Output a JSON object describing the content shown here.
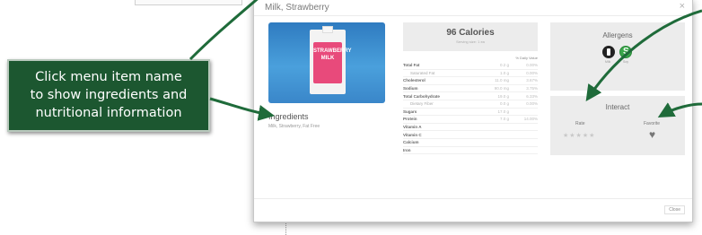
{
  "modal": {
    "title": "Milk, Strawberry",
    "close_glyph": "×",
    "footer_close": "Close"
  },
  "product": {
    "image_alt": "Strawberry milk carton",
    "carton_text": "STRAWBERRY MILK"
  },
  "ingredients": {
    "heading": "Ingredients",
    "text": "Milk, Strawberry, Fat Free"
  },
  "nutrition": {
    "calories": "96 Calories",
    "serving": "Serving size: 1 ea",
    "dv_header": "% Daily Value",
    "rows": [
      {
        "name": "Total Fat",
        "amount": "0.2 g",
        "pct": "0.00%",
        "sub": false
      },
      {
        "name": "Saturated Fat",
        "amount": "1.0 g",
        "pct": "0.00%",
        "sub": true
      },
      {
        "name": "Cholesterol",
        "amount": "11.0 mg",
        "pct": "3.67%",
        "sub": false
      },
      {
        "name": "Sodium",
        "amount": "90.0 mg",
        "pct": "3.75%",
        "sub": false
      },
      {
        "name": "Total Carbohydrate",
        "amount": "19.0 g",
        "pct": "6.33%",
        "sub": false
      },
      {
        "name": "Dietary Fiber",
        "amount": "0.0 g",
        "pct": "0.00%",
        "sub": true
      },
      {
        "name": "Sugars",
        "amount": "17.0 g",
        "pct": "",
        "sub": false
      },
      {
        "name": "Protein",
        "amount": "7.0 g",
        "pct": "14.00%",
        "sub": false
      },
      {
        "name": "Vitamin A",
        "amount": "",
        "pct": "",
        "sub": false
      },
      {
        "name": "Vitamin C",
        "amount": "",
        "pct": "",
        "sub": false
      },
      {
        "name": "Calcium",
        "amount": "",
        "pct": "",
        "sub": false
      },
      {
        "name": "Iron",
        "amount": "",
        "pct": "",
        "sub": false
      }
    ]
  },
  "allergens": {
    "title": "Allergens",
    "items": [
      {
        "icon": "milk-icon",
        "label": "Milk",
        "color": "#222222"
      },
      {
        "icon": "soy-icon",
        "label": "Soy",
        "color": "#3aa64a"
      }
    ]
  },
  "interact": {
    "title": "Interact",
    "rate_label": "Rate",
    "favorite_label": "Favorite",
    "stars": "★★★★★",
    "heart": "♥"
  },
  "callout": {
    "line1": "Click menu item name",
    "line2": "to show ingredients and",
    "line3": "nutritional information",
    "bg_color": "#1c5730",
    "arrow_color": "#1f6b3a"
  }
}
